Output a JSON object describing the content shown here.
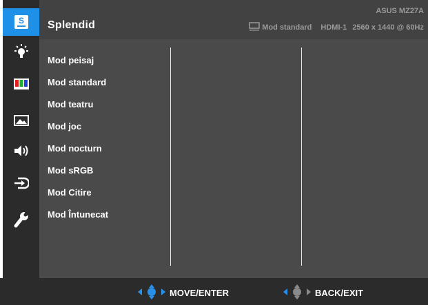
{
  "header": {
    "title": "Splendid",
    "model": "ASUS MZ27A",
    "current_mode": "Mod standard",
    "input": "HDMI-1",
    "resolution": "2560 x 1440 @ 60Hz"
  },
  "sidebar": {
    "items": [
      {
        "icon": "splendid-icon",
        "active": true
      },
      {
        "icon": "brightness-icon",
        "active": false
      },
      {
        "icon": "color-icon",
        "active": false
      },
      {
        "icon": "image-icon",
        "active": false
      },
      {
        "icon": "sound-icon",
        "active": false
      },
      {
        "icon": "input-select-icon",
        "active": false
      },
      {
        "icon": "system-setup-icon",
        "active": false
      }
    ]
  },
  "menu": {
    "items": [
      {
        "label": "Mod peisaj"
      },
      {
        "label": "Mod standard"
      },
      {
        "label": "Mod teatru"
      },
      {
        "label": "Mod joc"
      },
      {
        "label": "Mod nocturn"
      },
      {
        "label": "Mod sRGB"
      },
      {
        "label": "Mod Citire"
      },
      {
        "label": "Mod Întunecat"
      }
    ]
  },
  "footer": {
    "move_enter": "MOVE/ENTER",
    "back_exit": "BACK/EXIT"
  },
  "colors": {
    "accent": "#1e90e8",
    "header_bg": "#424242",
    "panel_bg": "#4a4a4a",
    "sidebar_bg": "#2b2b2b"
  }
}
